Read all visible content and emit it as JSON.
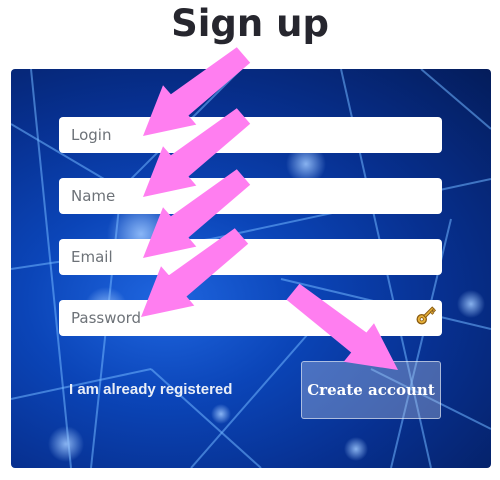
{
  "header": {
    "title": "Sign up"
  },
  "form": {
    "login_placeholder": "Login",
    "name_placeholder": "Name",
    "email_placeholder": "Email",
    "password_placeholder": "Password",
    "password_icon": "key-icon",
    "already_registered_label": "I am already registered",
    "create_account_label": "Create account"
  },
  "colors": {
    "annotation_arrow": "#ff7ef0",
    "card_background": "#0b3fae",
    "title_text": "#26262e"
  }
}
